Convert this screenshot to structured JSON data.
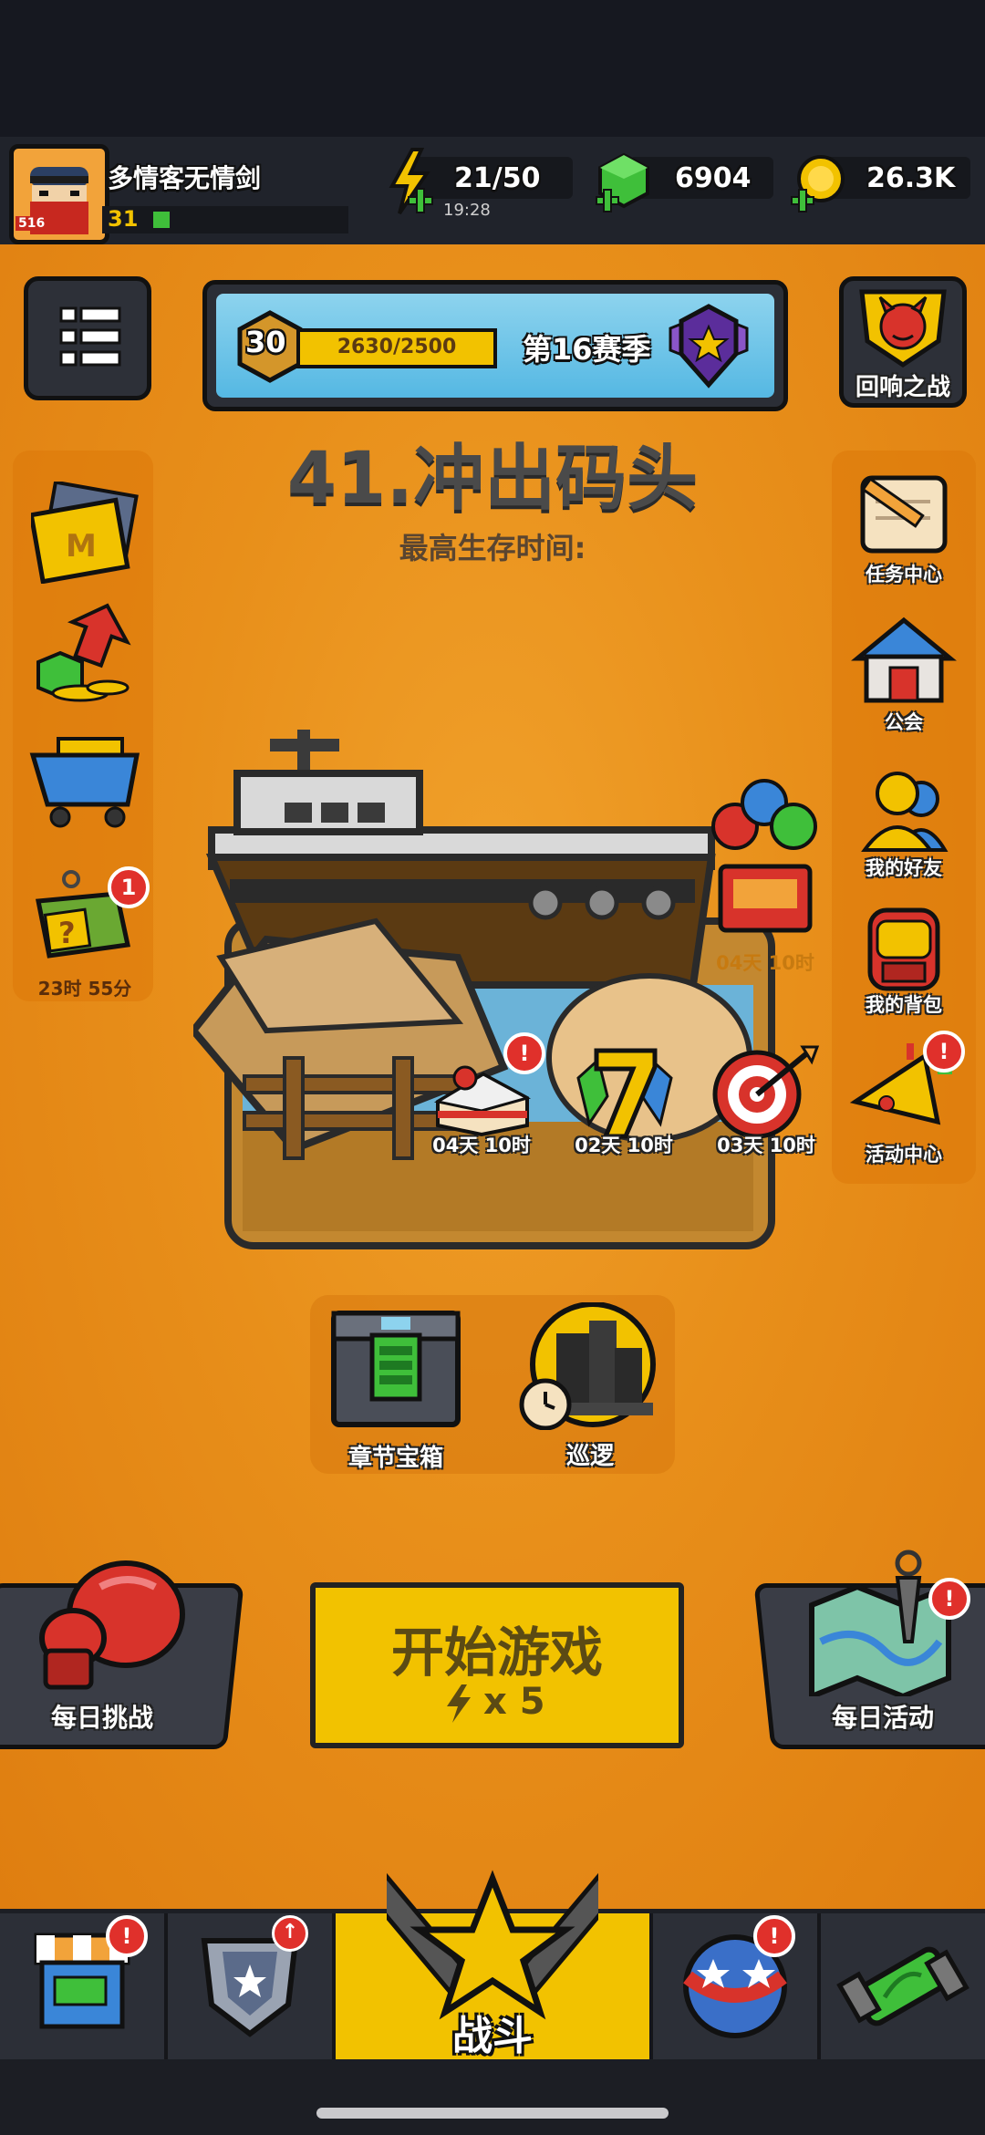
{
  "player": {
    "name": "多情客无情剑",
    "level": "31",
    "avatar_tag": "516"
  },
  "resources": {
    "energy": "21/50",
    "energy_timer": "19:28",
    "gems": "6904",
    "gold": "26.3K"
  },
  "season": {
    "rank_level": "30",
    "xp": "2630/2500",
    "xp_fraction": 1.0,
    "label": "第16赛季"
  },
  "header_right": {
    "echo_battle": "回响之战"
  },
  "chapter": {
    "title": "41.冲出码头",
    "best_survival": "最高生存时间:"
  },
  "left_sidebar": {
    "shop_timer": "23时 55分",
    "shop_badge": "1"
  },
  "right_sidebar": {
    "tasks": "任务中心",
    "guild": "公会",
    "friends": "我的好友",
    "backpack": "我的背包",
    "events": "活动中心"
  },
  "event_timers": {
    "cake_gift": "04天 10时",
    "cake_event": "04天 10时",
    "lucky7": "02天 10时",
    "target": "03天 10时"
  },
  "chapter_actions": {
    "chest": "章节宝箱",
    "patrol": "巡逻"
  },
  "play": {
    "daily_challenge": "每日挑战",
    "start_game": "开始游戏",
    "energy_cost": "x 5",
    "daily_event": "每日活动"
  },
  "nav": {
    "battle": "战斗"
  },
  "colors": {
    "orange_bg": "#e88f1a",
    "yellow_button": "#f2c200",
    "badge_red": "#e0302b",
    "gem_green": "#3fbf3a"
  }
}
